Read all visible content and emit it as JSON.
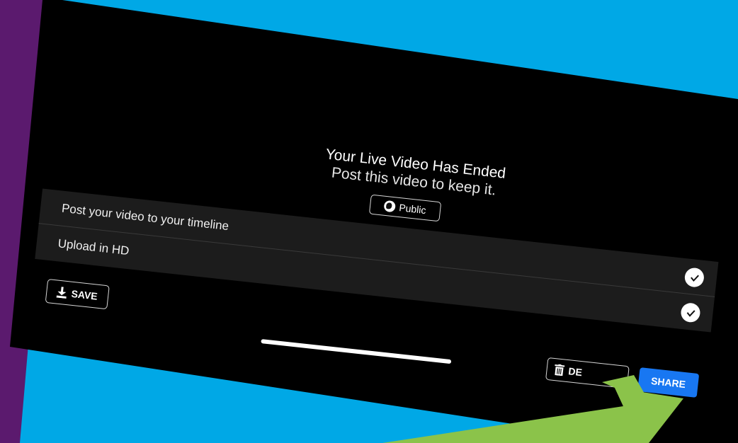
{
  "end_screen": {
    "title": "Your Live Video Has Ended",
    "subtitle": "Post this video to keep it.",
    "audience_label": "Public"
  },
  "options": [
    {
      "label": "Post your video to your timeline",
      "checked": true
    },
    {
      "label": "Upload in HD",
      "checked": true
    }
  ],
  "actions": {
    "save_label": "SAVE",
    "delete_label": "DE",
    "share_label": "SHARE"
  },
  "colors": {
    "background": "#00a8e6",
    "purple_accent": "#5b1a6e",
    "screen": "#000000",
    "options_panel": "#1c1c1c",
    "share_button": "#1877f2",
    "arrow": "#8bc34a"
  },
  "icons": {
    "audience": "globe-icon",
    "save": "download-icon",
    "delete": "trash-icon",
    "check": "check-circle-icon",
    "callout": "arrow-annotation"
  }
}
